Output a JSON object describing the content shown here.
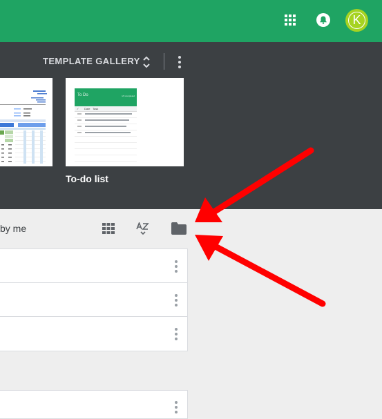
{
  "header": {
    "apps_icon": "apps-grid-icon",
    "notifications_icon": "bell-icon",
    "avatar_initial": "K",
    "brand_color": "#1fa463"
  },
  "gallery": {
    "title": "TEMPLATE GALLERY",
    "expand_icon": "unfold-more-icon",
    "more_icon": "more-vert-icon",
    "templates": [
      {
        "label": ""
      },
      {
        "label": "To-do list",
        "preview_title": "To Do",
        "preview_subtitle": "1/3 completed",
        "preview_columns": [
          "✓",
          "Date",
          "Task"
        ]
      }
    ]
  },
  "docs_toolbar": {
    "owner_filter_label": "by me",
    "grid_view_icon": "grid-view-icon",
    "sort_icon": "sort-az-icon",
    "folder_icon": "folder-icon"
  },
  "annotations": {
    "arrow_color": "#ff0000",
    "arrow_count": 2
  }
}
